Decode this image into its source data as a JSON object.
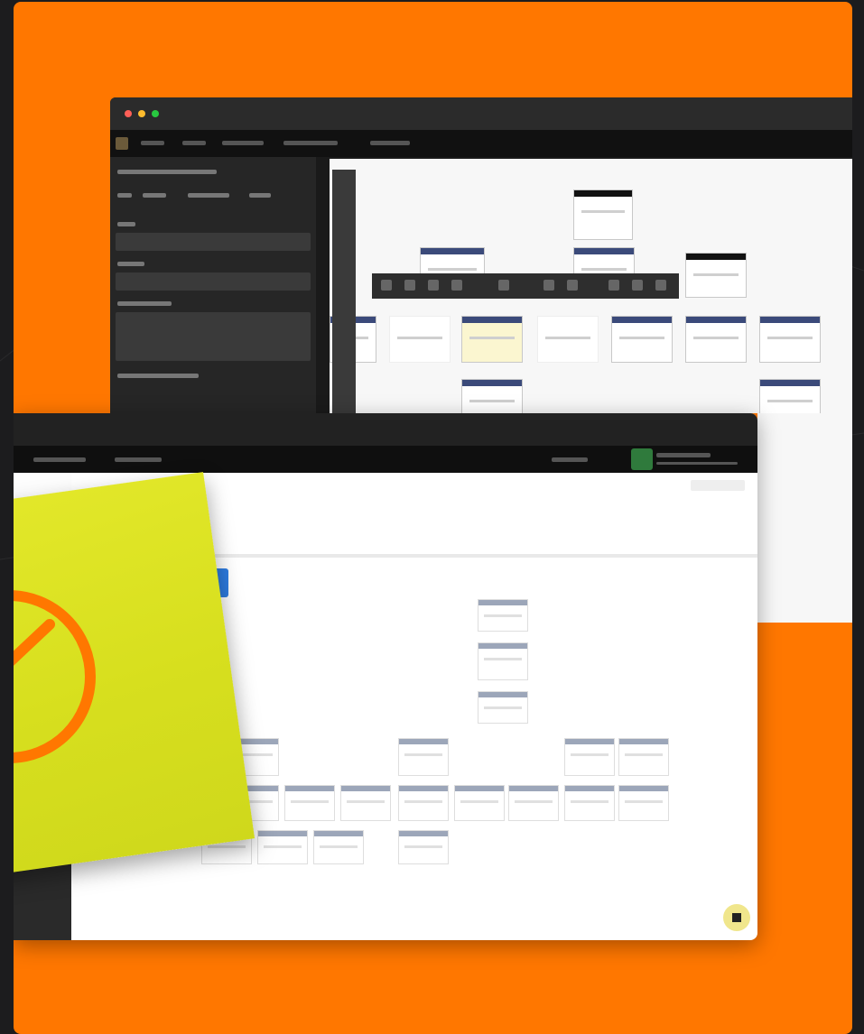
{
  "colors": {
    "background": "#1c1c1e",
    "panel": "#ff7700",
    "sticky_note": "#d7df1e",
    "check_icon": "#ff7700",
    "dot_red": "#ff5f57",
    "dot_yellow": "#febc2e",
    "dot_green": "#28c840"
  },
  "icons": [
    "window-close-dot",
    "window-minimize-dot",
    "window-maximize-dot",
    "check-circle-icon",
    "avatar-icon",
    "help-fab-icon"
  ]
}
